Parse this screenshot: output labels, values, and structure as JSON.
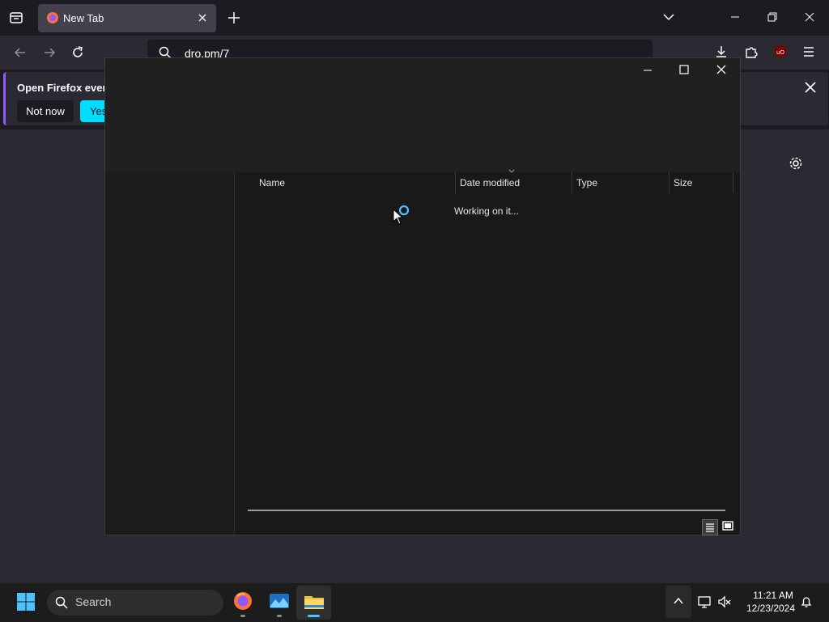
{
  "browser": {
    "tab_title": "New Tab",
    "url": "dro.pm/7"
  },
  "notification": {
    "text": "Open Firefox every",
    "not_now": "Not now",
    "yes": "Yes"
  },
  "dialog": {
    "columns": [
      "Name",
      "Date modified",
      "Type",
      "Size"
    ],
    "status": "Working on it..."
  },
  "taskbar": {
    "search_placeholder": "Search",
    "time": "11:21 AM",
    "date": "12/23/2024"
  },
  "colors": {
    "accent_cyan": "#00ddff",
    "progress_blue": "#4cc2ff",
    "notification_border": "#9059ff"
  }
}
